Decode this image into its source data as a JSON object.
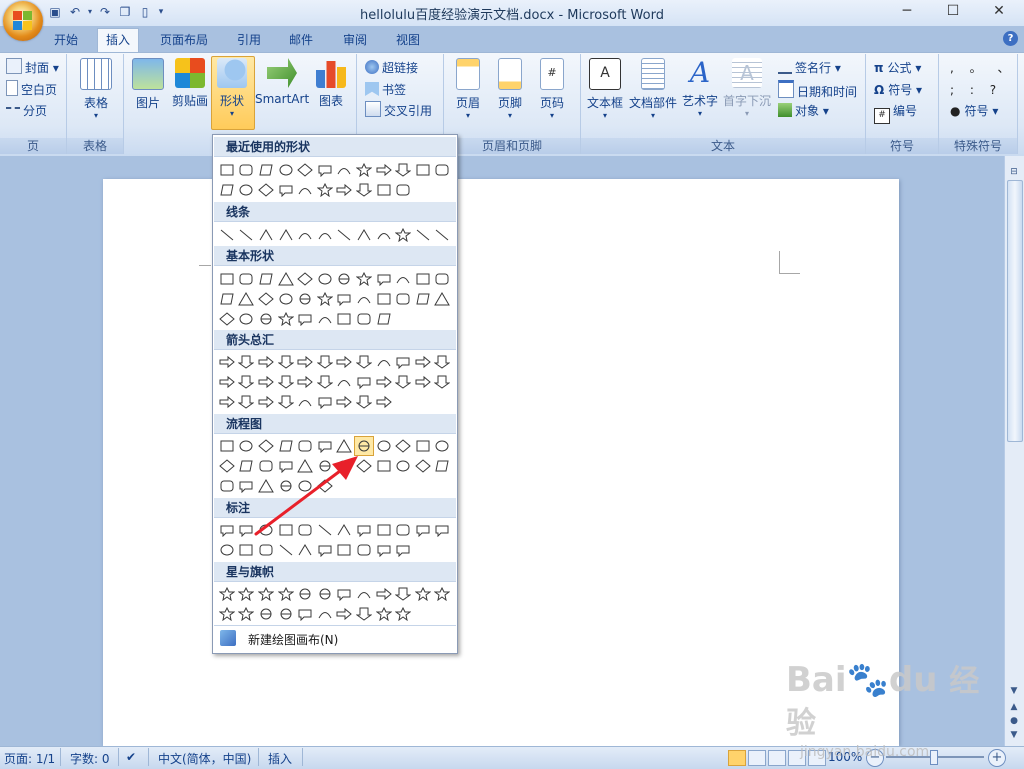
{
  "window": {
    "title": "hellolulu百度经验演示文档.docx - Microsoft Word",
    "minimize": "─",
    "maximize": "☐",
    "close": "✕"
  },
  "qat": [
    "save-icon",
    "undo-icon",
    "dropdown-arrow-icon",
    "redo-icon",
    "copy-icon",
    "new-doc-icon",
    "customize-icon"
  ],
  "tabs": [
    {
      "label": "开始",
      "active": false
    },
    {
      "label": "插入",
      "active": true
    },
    {
      "label": "页面布局",
      "active": false
    },
    {
      "label": "引用",
      "active": false
    },
    {
      "label": "邮件",
      "active": false
    },
    {
      "label": "审阅",
      "active": false
    },
    {
      "label": "视图",
      "active": false
    }
  ],
  "help": "?",
  "ribbon": {
    "pages": {
      "label": "页",
      "cover": "封面",
      "blank": "空白页",
      "break": "分页"
    },
    "tables": {
      "label": "表格",
      "table": "表格"
    },
    "illustrations": {
      "picture": "图片",
      "clipart": "剪贴画",
      "shapes": "形状",
      "smartart": "SmartArt",
      "chart": "图表"
    },
    "links": {
      "hyperlink": "超链接",
      "bookmark": "书签",
      "crossref": "交叉引用"
    },
    "header_footer": {
      "label": "页眉和页脚",
      "header": "页眉",
      "footer": "页脚",
      "page_number": "页码"
    },
    "text": {
      "label": "文本",
      "textbox": "文本框",
      "quickparts": "文档部件",
      "wordart": "艺术字",
      "dropcap": "首字下沉",
      "signature": "签名行",
      "datetime": "日期和时间",
      "object": "对象"
    },
    "symbols": {
      "label": "符号",
      "equation": "公式",
      "symbol": "符号",
      "number": "编号"
    },
    "special": {
      "label": "特殊符号",
      "symbol": "符号",
      "row1": ", 。 、",
      "row2": "; : ?"
    }
  },
  "dropdown": {
    "sections": [
      {
        "title": "最近使用的形状"
      },
      {
        "title": "线条"
      },
      {
        "title": "基本形状"
      },
      {
        "title": "箭头总汇"
      },
      {
        "title": "流程图"
      },
      {
        "title": "标注"
      },
      {
        "title": "星与旗帜"
      }
    ],
    "new_canvas": "新建绘图画布(N)"
  },
  "status": {
    "page": "页面: 1/1",
    "words": "字数: 0",
    "language": "中文(简体，中国)",
    "mode": "插入",
    "zoom": "100%"
  },
  "watermark": {
    "brand": "Bai",
    "brand2": "du",
    "suffix": "经验",
    "url": "jingyan.baidu.com"
  },
  "colors": {
    "accent": "#15428b",
    "arrow": "#e8202a",
    "selected": "#ffe9a6"
  }
}
